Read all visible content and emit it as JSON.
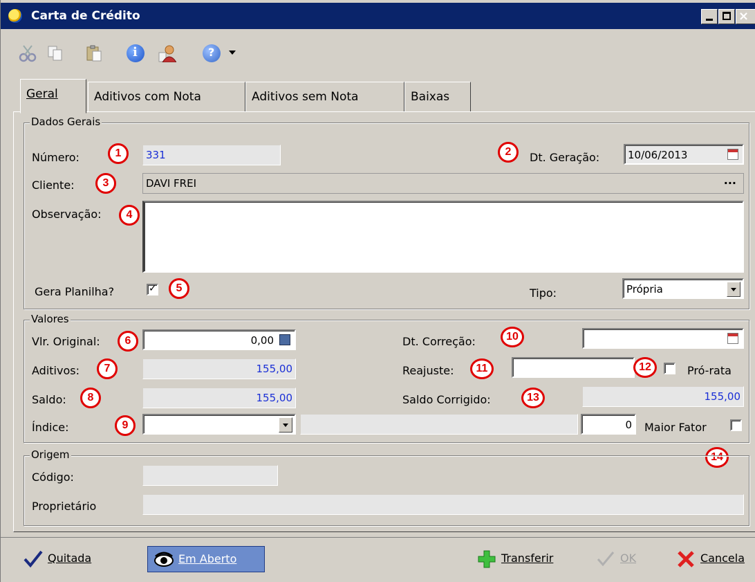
{
  "window": {
    "title": "Carta de Crédito"
  },
  "toolbar": {
    "icons": [
      "cut-icon",
      "copy-icon",
      "paste-icon",
      "info-icon",
      "user-properties-icon",
      "help-icon",
      "dropdown-caret-icon"
    ]
  },
  "tabs": [
    {
      "label": "Geral",
      "active": true
    },
    {
      "label": "Aditivos com Nota",
      "active": false
    },
    {
      "label": "Aditivos sem Nota",
      "active": false
    },
    {
      "label": "Baixas",
      "active": false
    }
  ],
  "dados_gerais": {
    "legend": "Dados Gerais",
    "numero_label": "Número:",
    "numero_value": "331",
    "dt_geracao_label": "Dt. Geração:",
    "dt_geracao_value": "10/06/2013",
    "cliente_label": "Cliente:",
    "cliente_value": "DAVI FREI",
    "cliente_lookup": "...",
    "observacao_label": "Observação:",
    "observacao_value": "",
    "gera_planilha_label": "Gera Planilha?",
    "gera_planilha_checked": true,
    "tipo_label": "Tipo:",
    "tipo_value": "Própria"
  },
  "valores": {
    "legend": "Valores",
    "vlr_original_label": "Vlr. Original:",
    "vlr_original_value": "0,00",
    "aditivos_label": "Aditivos:",
    "aditivos_value": "155,00",
    "saldo_label": "Saldo:",
    "saldo_value": "155,00",
    "indice_label": "Índice:",
    "indice_value": "",
    "indice_desc": "",
    "indice_number": "0",
    "maior_fator_label": "Maior Fator",
    "maior_fator_checked": false,
    "dt_correcao_label": "Dt. Correção:",
    "dt_correcao_value": "",
    "reajuste_label": "Reajuste:",
    "reajuste_value": "",
    "pro_rata_label": "Pró-rata",
    "pro_rata_checked": false,
    "saldo_corrigido_label": "Saldo Corrigido:",
    "saldo_corrigido_value": "155,00"
  },
  "origem": {
    "legend": "Origem",
    "codigo_label": "Código:",
    "codigo_value": "",
    "proprietario_label": "Proprietário",
    "proprietario_value": ""
  },
  "badges": [
    "1",
    "2",
    "3",
    "4",
    "5",
    "6",
    "7",
    "8",
    "9",
    "10",
    "11",
    "12",
    "13",
    "14"
  ],
  "actions": {
    "quitada": "Quitada",
    "em_aberto": "Em Aberto",
    "transferir": "Transferir",
    "ok": "OK",
    "cancela": "Cancela"
  },
  "colors": {
    "titlebar": "#0a246a",
    "window_bg": "#d4d0c8",
    "value_blue": "#1a2fd6",
    "badge_red": "#e00000",
    "selected_button": "#6c8ccc"
  }
}
